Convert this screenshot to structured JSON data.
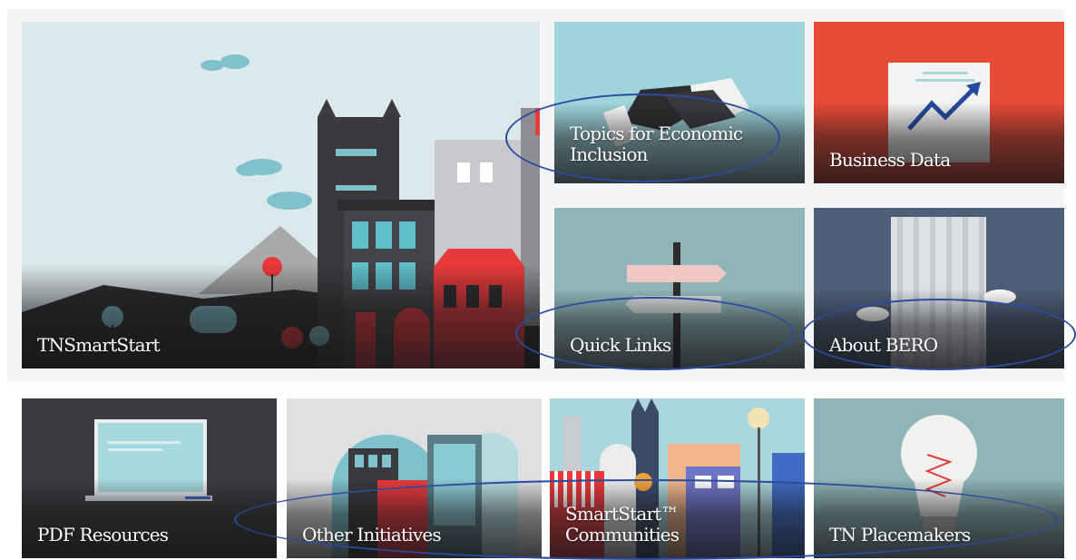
{
  "tiles": {
    "tnsmartstart": "TNSmartStart",
    "topics": "Topics for Economic Inclusion",
    "business_data": "Business Data",
    "quick_links": "Quick Links",
    "about_bero": "About BERO",
    "pdf_resources": "PDF Resources",
    "other_initiatives": "Other Initiatives",
    "smartstart_communities": "SmartStart™ Communities",
    "tn_placemakers": "TN Placemakers"
  },
  "colors": {
    "annotation_oval": "#2c4aa0",
    "business_data_bg": "#e74a36",
    "about_bero_bg": "#4d5f78",
    "topics_bg": "#9fd4db",
    "quick_links_bg": "#8fb5b8"
  },
  "icons": {
    "tnsmartstart": "city-illustration-icon",
    "topics": "handshake-icon",
    "business_data": "trend-chart-icon",
    "quick_links": "signpost-icon",
    "about_bero": "office-tower-icon",
    "pdf_resources": "laptop-icon",
    "other_initiatives": "storefronts-icon",
    "smartstart_communities": "downtown-icon",
    "tn_placemakers": "lightbulb-icon"
  }
}
